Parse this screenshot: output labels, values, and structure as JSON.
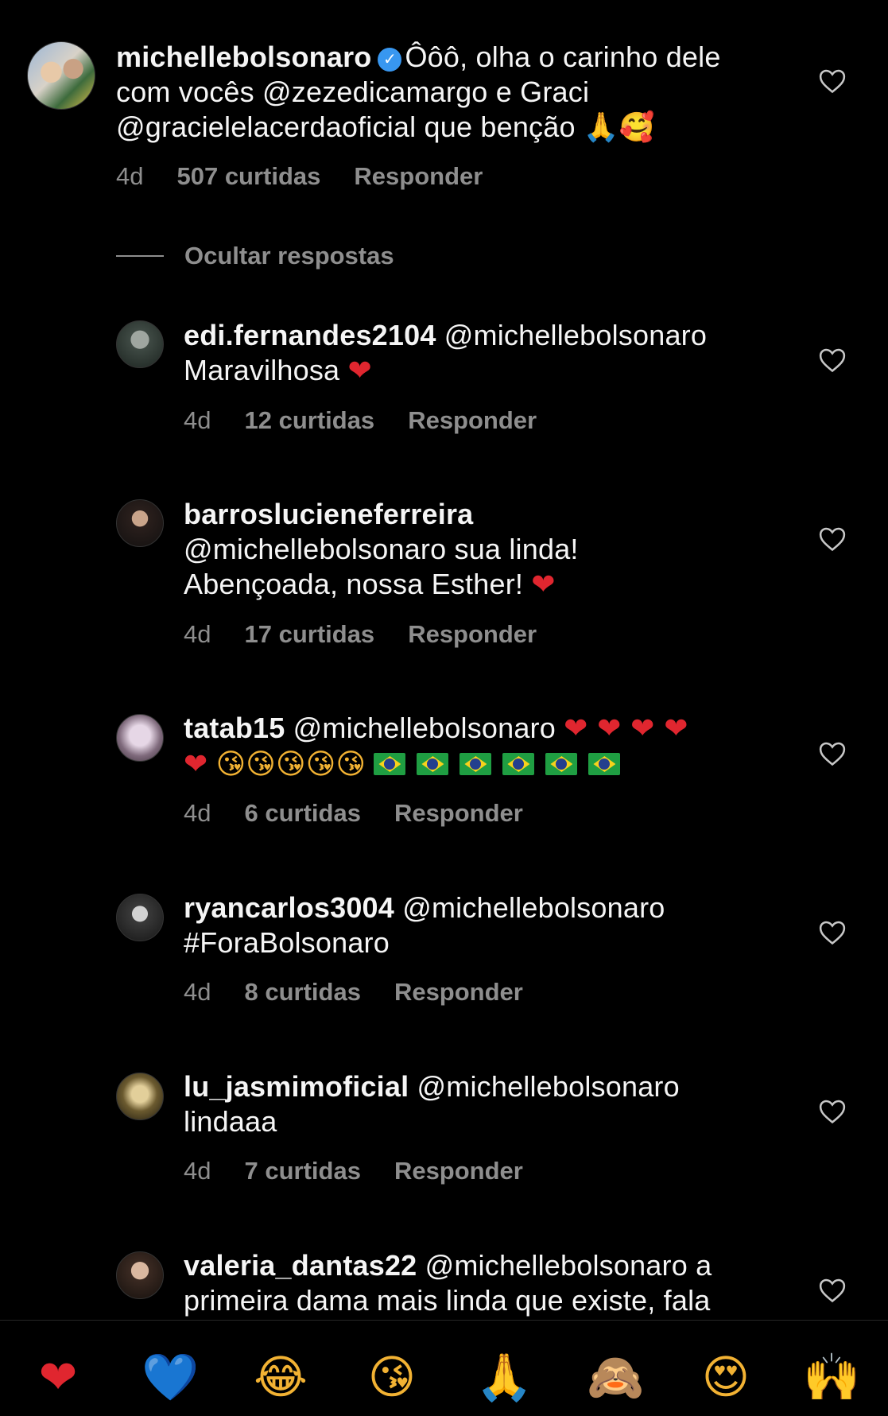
{
  "main_comment": {
    "username": "michellebolsonaro",
    "verified_icon": "verified-badge-icon",
    "text_line1": "Ôôô, olha o carinho dele",
    "text_line2": "com vocês @zezedicamargo e Graci",
    "text_line3": "@gracielelacerdaoficial que benção",
    "emojis": "🙏🥰",
    "time": "4d",
    "likes": "507 curtidas",
    "reply": "Responder"
  },
  "hide_replies": "Ocultar respostas",
  "replies": [
    {
      "username": "edi.fernandes2104",
      "line1": "@michellebolsonaro",
      "line2": "Maravilhosa",
      "emoji": "❤",
      "time": "4d",
      "likes": "12 curtidas",
      "reply": "Responder"
    },
    {
      "username": "barroslucieneferreira",
      "line1": "@michellebolsonaro sua linda!",
      "line2": "Abençoada, nossa Esther!",
      "emoji": "❤",
      "time": "4d",
      "likes": "17 curtidas",
      "reply": "Responder"
    },
    {
      "username": "tatab15",
      "line1": "@michellebolsonaro",
      "hearts1": "❤ ❤ ❤ ❤",
      "line2_hearts": "❤",
      "kisses": "😘😘😘😘😘",
      "flags_count": "6",
      "time": "4d",
      "likes": "6 curtidas",
      "reply": "Responder"
    },
    {
      "username": "ryancarlos3004",
      "line1": "@michellebolsonaro",
      "line2": "#ForaBolsonaro",
      "time": "4d",
      "likes": "8 curtidas",
      "reply": "Responder"
    },
    {
      "username": "lu_jasmimoficial",
      "line1": "@michellebolsonaro",
      "line2": "lindaaa",
      "time": "4d",
      "likes": "7 curtidas",
      "reply": "Responder"
    },
    {
      "username": "valeria_dantas22",
      "line1": "@michellebolsonaro a",
      "line2": "primeira dama mais linda que existe, fala"
    }
  ],
  "reactions": [
    "❤",
    "💙",
    "😂",
    "😘",
    "🙏",
    "🙈",
    "😍",
    "🙌"
  ],
  "colors": {
    "background": "#000000",
    "text": "#f5f5f5",
    "secondary": "#8e8e8e",
    "verified": "#3897f0",
    "heart": "#e0262f"
  }
}
